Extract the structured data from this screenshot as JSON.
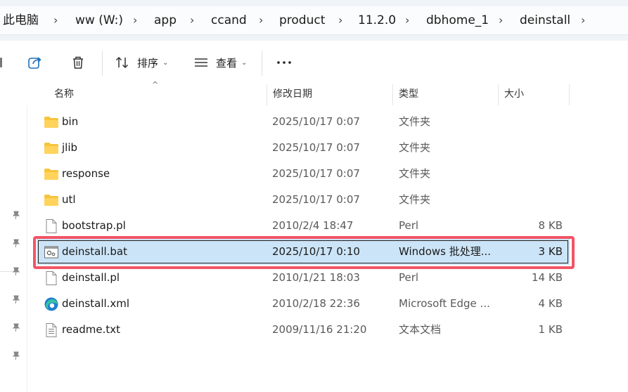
{
  "breadcrumb": {
    "items": [
      "此电脑",
      "ww (W:)",
      "app",
      "ccand",
      "product",
      "11.2.0",
      "dbhome_1",
      "deinstall"
    ]
  },
  "toolbar": {
    "sort_label": "排序",
    "view_label": "查看",
    "more_label": "..."
  },
  "columns": {
    "name": "名称",
    "date": "修改日期",
    "type": "类型",
    "size": "大小"
  },
  "files": [
    {
      "name": "bin",
      "date": "2025/10/17 0:07",
      "type": "文件夹",
      "size": "",
      "icon": "folder-icon"
    },
    {
      "name": "jlib",
      "date": "2025/10/17 0:07",
      "type": "文件夹",
      "size": "",
      "icon": "folder-icon"
    },
    {
      "name": "response",
      "date": "2025/10/17 0:07",
      "type": "文件夹",
      "size": "",
      "icon": "folder-icon"
    },
    {
      "name": "utl",
      "date": "2025/10/17 0:07",
      "type": "文件夹",
      "size": "",
      "icon": "folder-icon"
    },
    {
      "name": "bootstrap.pl",
      "date": "2010/2/4 18:47",
      "type": "Perl",
      "size": "8 KB",
      "icon": "file-icon"
    },
    {
      "name": "deinstall.bat",
      "date": "2025/10/17 0:10",
      "type": "Windows 批处理...",
      "size": "3 KB",
      "icon": "batch-file-icon",
      "selected": true
    },
    {
      "name": "deinstall.pl",
      "date": "2010/1/21 18:03",
      "type": "Perl",
      "size": "14 KB",
      "icon": "file-icon"
    },
    {
      "name": "deinstall.xml",
      "date": "2010/2/18 22:36",
      "type": "Microsoft Edge ...",
      "size": "4 KB",
      "icon": "edge-icon"
    },
    {
      "name": "readme.txt",
      "date": "2009/11/16 21:20",
      "type": "文本文档",
      "size": "1 KB",
      "icon": "text-file-icon"
    }
  ],
  "colors": {
    "folder": "#f8c43a",
    "selection": "#cce4f7",
    "highlight": "#f25566"
  }
}
